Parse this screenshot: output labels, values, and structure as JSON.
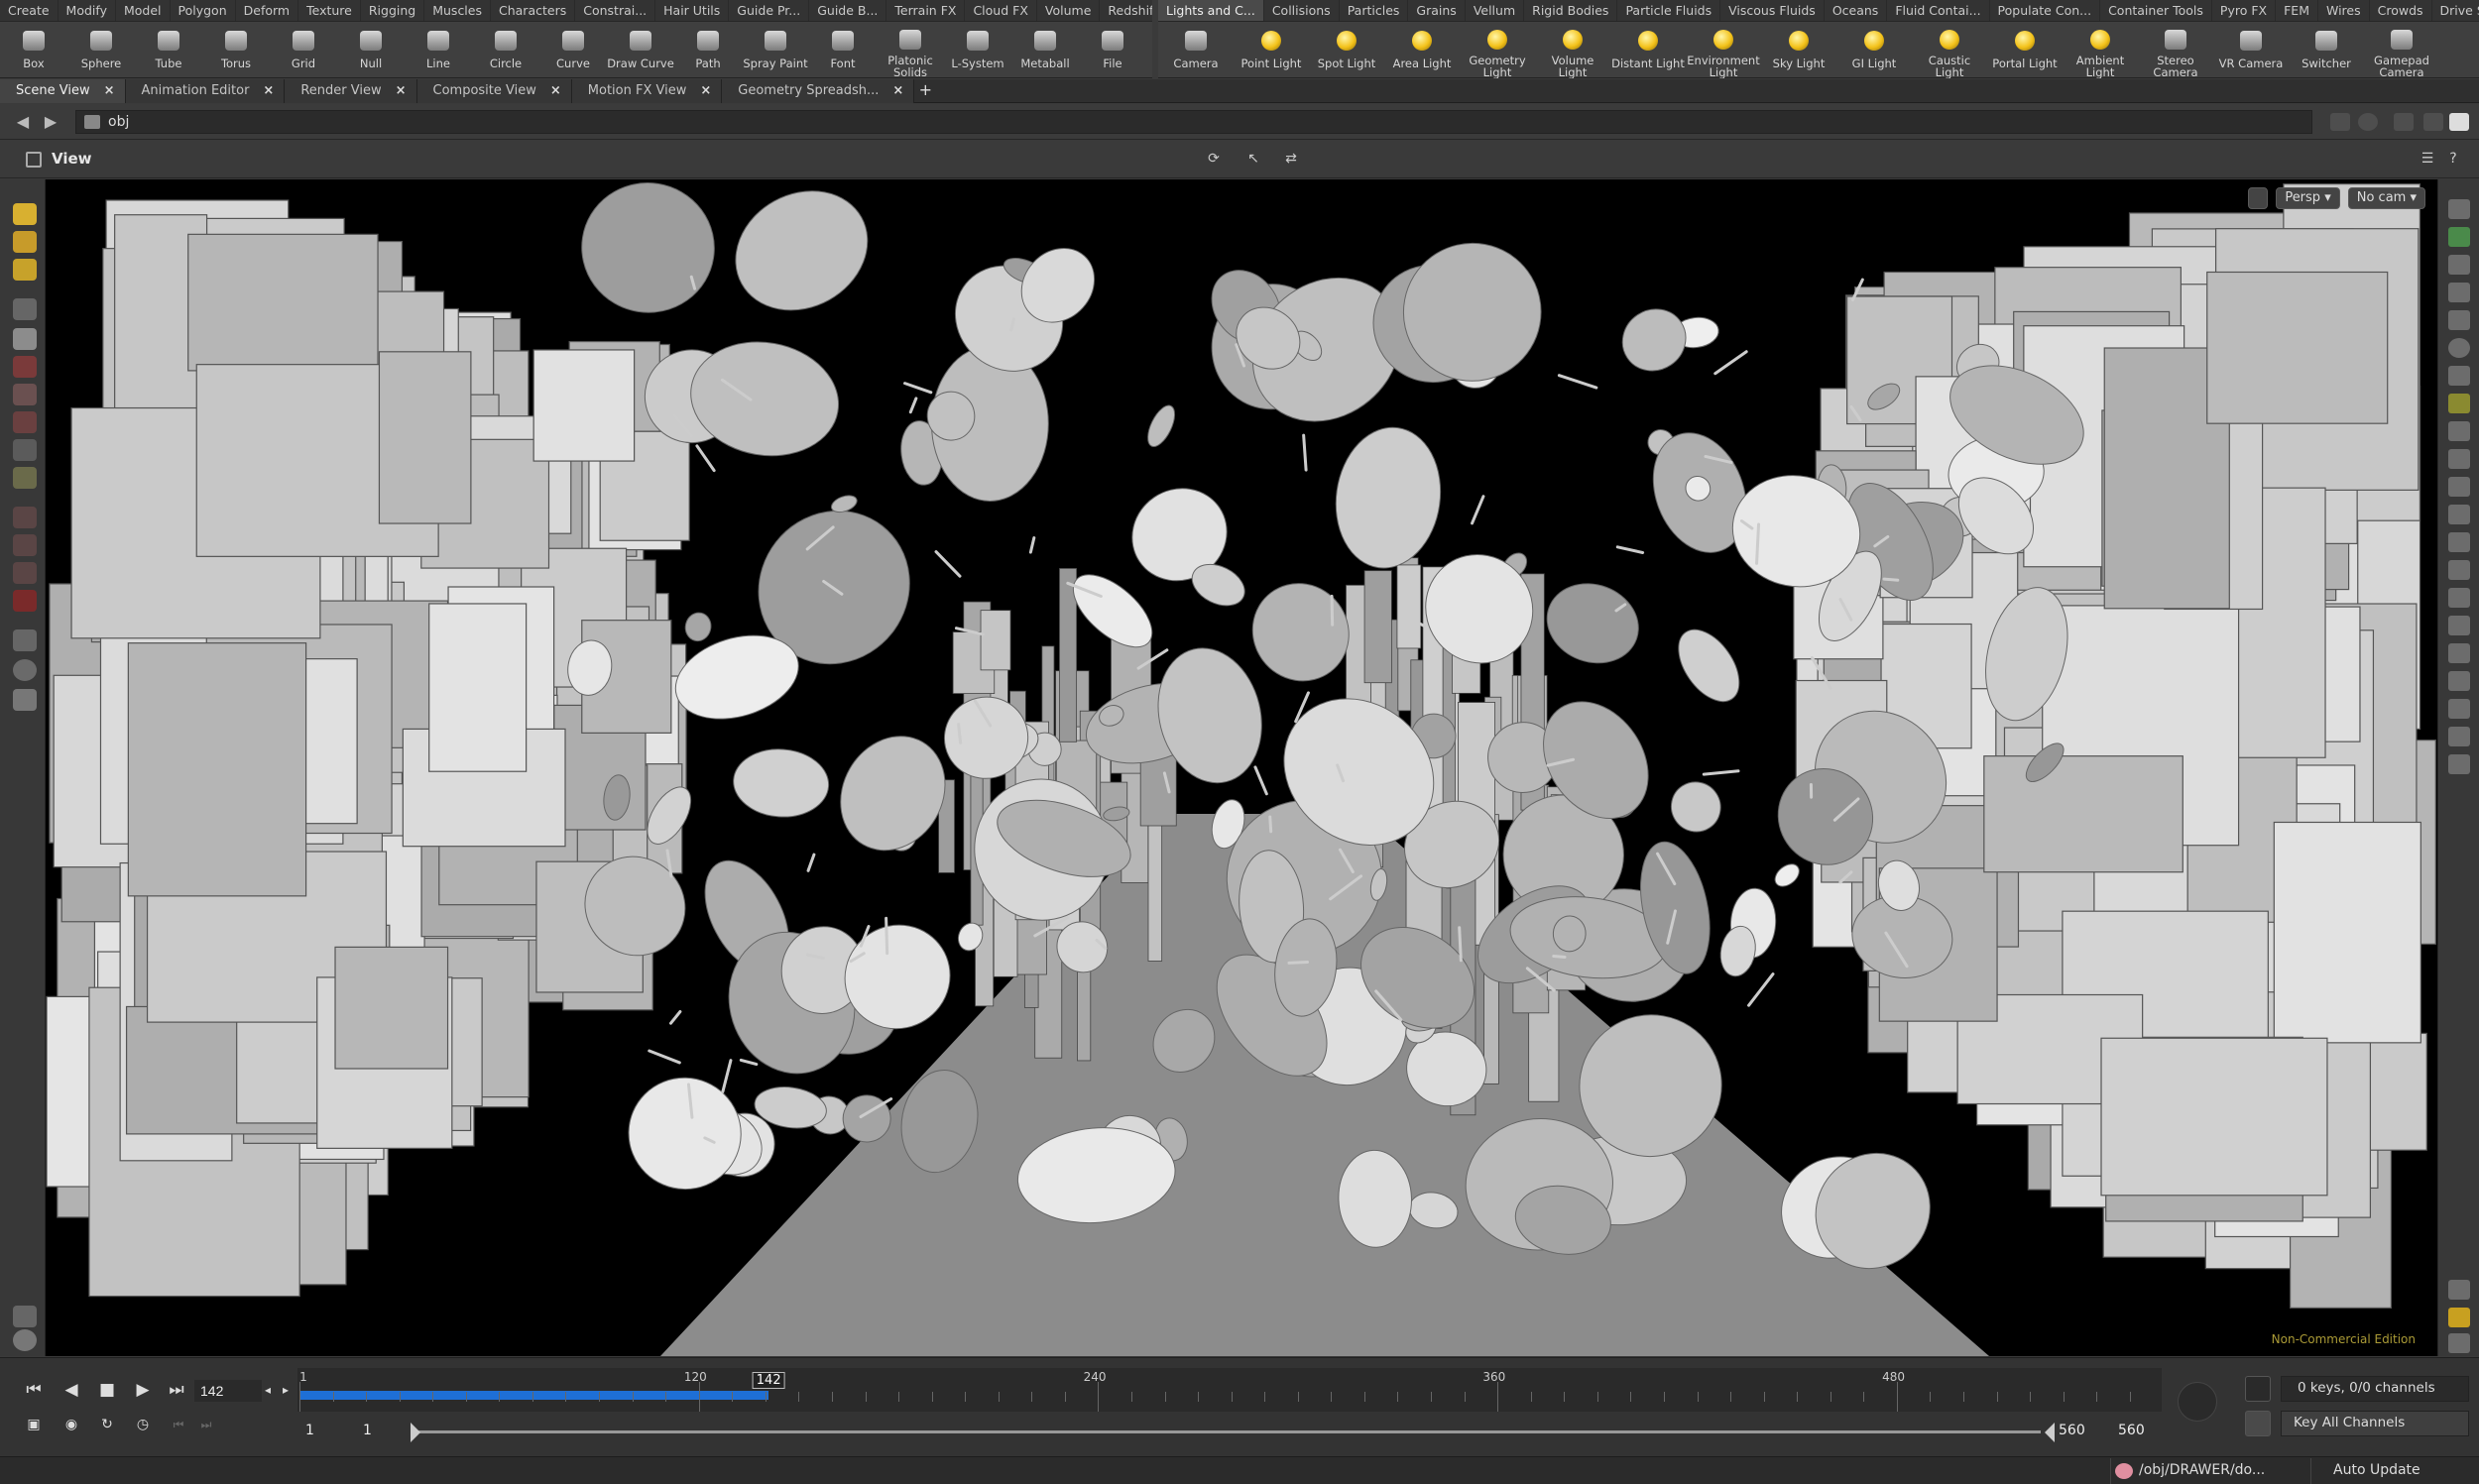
{
  "shelf_left": {
    "tabs": [
      "Create",
      "Modify",
      "Model",
      "Polygon",
      "Deform",
      "Texture",
      "Rigging",
      "Muscles",
      "Characters",
      "Constrai...",
      "Hair Utils",
      "Guide Pr...",
      "Guide B...",
      "Terrain FX",
      "Cloud FX",
      "Volume",
      "Redshift",
      "+"
    ],
    "tools": [
      {
        "label": "Box",
        "icon": "box-icon"
      },
      {
        "label": "Sphere",
        "icon": "sphere-icon"
      },
      {
        "label": "Tube",
        "icon": "tube-icon"
      },
      {
        "label": "Torus",
        "icon": "torus-icon"
      },
      {
        "label": "Grid",
        "icon": "grid-icon"
      },
      {
        "label": "Null",
        "icon": "null-icon"
      },
      {
        "label": "Line",
        "icon": "line-icon"
      },
      {
        "label": "Circle",
        "icon": "circle-icon"
      },
      {
        "label": "Curve",
        "icon": "curve-icon"
      },
      {
        "label": "Draw Curve",
        "icon": "draw-curve-icon"
      },
      {
        "label": "Path",
        "icon": "path-icon"
      },
      {
        "label": "Spray Paint",
        "icon": "spray-paint-icon"
      },
      {
        "label": "Font",
        "icon": "font-icon"
      },
      {
        "label": "Platonic Solids",
        "icon": "platonic-solids-icon"
      },
      {
        "label": "L-System",
        "icon": "l-system-icon"
      },
      {
        "label": "Metaball",
        "icon": "metaball-icon"
      },
      {
        "label": "File",
        "icon": "file-icon"
      }
    ]
  },
  "shelf_right": {
    "tabs": [
      "Lights and C...",
      "Collisions",
      "Particles",
      "Grains",
      "Vellum",
      "Rigid Bodies",
      "Particle Fluids",
      "Viscous Fluids",
      "Oceans",
      "Fluid Contai...",
      "Populate Con...",
      "Container Tools",
      "Pyro FX",
      "FEM",
      "Wires",
      "Crowds",
      "Drive Simula..."
    ],
    "tools": [
      {
        "label": "Camera",
        "icon": "camera-icon"
      },
      {
        "label": "Point Light",
        "icon": "point-light-icon"
      },
      {
        "label": "Spot Light",
        "icon": "spot-light-icon"
      },
      {
        "label": "Area Light",
        "icon": "area-light-icon"
      },
      {
        "label": "Geometry Light",
        "icon": "geometry-light-icon"
      },
      {
        "label": "Volume Light",
        "icon": "volume-light-icon"
      },
      {
        "label": "Distant Light",
        "icon": "distant-light-icon"
      },
      {
        "label": "Environment Light",
        "icon": "environment-light-icon"
      },
      {
        "label": "Sky Light",
        "icon": "sky-light-icon"
      },
      {
        "label": "GI Light",
        "icon": "gi-light-icon"
      },
      {
        "label": "Caustic Light",
        "icon": "caustic-light-icon"
      },
      {
        "label": "Portal Light",
        "icon": "portal-light-icon"
      },
      {
        "label": "Ambient Light",
        "icon": "ambient-light-icon"
      },
      {
        "label": "Stereo Camera",
        "icon": "stereo-camera-icon"
      },
      {
        "label": "VR Camera",
        "icon": "vr-camera-icon"
      },
      {
        "label": "Switcher",
        "icon": "switcher-icon"
      },
      {
        "label": "Gamepad Camera",
        "icon": "gamepad-camera-icon"
      }
    ]
  },
  "pane_tabs": [
    "Scene View",
    "Animation Editor",
    "Render View",
    "Composite View",
    "Motion FX View",
    "Geometry Spreadsh..."
  ],
  "path": {
    "value": "obj"
  },
  "view": {
    "title": "View",
    "projection": "Persp",
    "camera": "No cam",
    "watermark": "Non-Commercial Edition"
  },
  "timeline": {
    "current_frame": "142",
    "cursor_label": "142",
    "start": 1,
    "end": 560,
    "current": 142,
    "tick_labels": [
      "1",
      "120",
      "240",
      "360",
      "480"
    ],
    "tick_values": [
      1,
      120,
      240,
      360,
      480
    ],
    "range_start_a": "1",
    "range_start_b": "1",
    "range_end_a": "560",
    "range_end_b": "560",
    "keys_status": "0 keys, 0/0 channels",
    "key_all": "Key All Channels"
  },
  "status": {
    "network_path": "/obj/DRAWER/do...",
    "update_mode": "Auto Update"
  },
  "colors": {
    "accent": "#1e6fd6",
    "light_icon": "#f3c21a",
    "watermark": "#c8b640"
  }
}
